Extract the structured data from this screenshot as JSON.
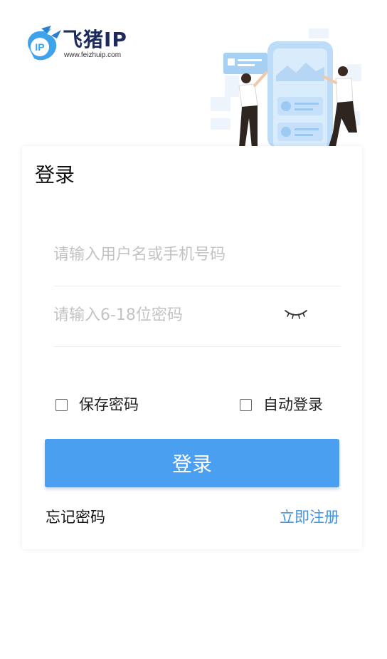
{
  "brand": {
    "logo_text": "IP",
    "name": "飞猪IP",
    "url": "www.feizhuip.com",
    "color": "#1d2a5c",
    "accent": "#3fa3ec"
  },
  "login": {
    "title": "登录",
    "username_placeholder": "请输入用户名或手机号码",
    "password_placeholder": "请输入6-18位密码",
    "save_password_label": "保存密码",
    "save_password_checked": false,
    "auto_login_label": "自动登录",
    "auto_login_checked": false,
    "submit_label": "登录",
    "forgot_label": "忘记密码",
    "register_label": "立即注册"
  },
  "colors": {
    "primary_button": "#4a9ff0",
    "link": "#3f93e6"
  },
  "icons": {
    "password_toggle": "eye-closed-icon",
    "illustration": "people-phone-illustration"
  }
}
